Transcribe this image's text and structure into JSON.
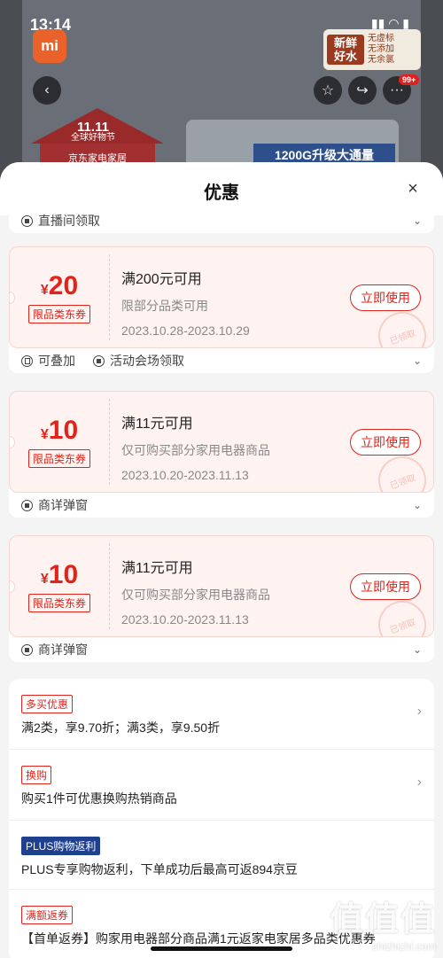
{
  "status_bar": {
    "time": "13:14"
  },
  "background_page": {
    "brand_logo": "mi",
    "promo_badge": {
      "big": "新鲜好水",
      "small": [
        "无虚标",
        "无添加",
        "无余氯"
      ]
    },
    "badge_count": "99+",
    "banner_11": "11.11",
    "banner_11_sub": "全球好物节",
    "banner_house": "京东家电家居",
    "product_label": "1200G升级大通量",
    "icons": [
      "back-icon",
      "star-icon",
      "share-icon",
      "more-icon"
    ]
  },
  "sheet": {
    "title": "优惠",
    "close": "×"
  },
  "partial_top": {
    "tag": "直播间领取"
  },
  "coupons": [
    {
      "currency": "¥",
      "amount": "20",
      "type": "限品类东券",
      "condition": "满200元可用",
      "scope": "限部分品类可用",
      "date": "2023.10.28-2023.10.29",
      "button": "立即使用",
      "stamp": "已领取",
      "tags": [
        "可叠加",
        "活动会场领取"
      ]
    },
    {
      "currency": "¥",
      "amount": "10",
      "type": "限品类东券",
      "condition": "满11元可用",
      "scope": "仅可购买部分家用电器商品",
      "date": "2023.10.20-2023.11.13",
      "button": "立即使用",
      "stamp": "已领取",
      "tags": [
        "商详弹窗"
      ]
    },
    {
      "currency": "¥",
      "amount": "10",
      "type": "限品类东券",
      "condition": "满11元可用",
      "scope": "仅可购买部分家用电器商品",
      "date": "2023.10.20-2023.11.13",
      "button": "立即使用",
      "stamp": "已领取",
      "tags": [
        "商详弹窗"
      ]
    }
  ],
  "offers": [
    {
      "tag": "多买优惠",
      "text": "满2类，享9.70折；满3类，享9.50折"
    },
    {
      "tag": "换购",
      "text": "购买1件可优惠换购热销商品"
    },
    {
      "tag": "PLUS购物返利",
      "text": "PLUS专享购物返利，下单成功后最高可返894京豆"
    },
    {
      "tag": "满额返券",
      "text": "【首单返券】购家用电器部分商品满1元返家电家居多品类优惠券"
    }
  ],
  "watermark": {
    "big": "值值值",
    "small": "zhizhizhi.com"
  },
  "colors": {
    "accent": "#e2231a",
    "coupon_bg": "#fff3f1",
    "plus_blue": "#1f3f8f"
  }
}
